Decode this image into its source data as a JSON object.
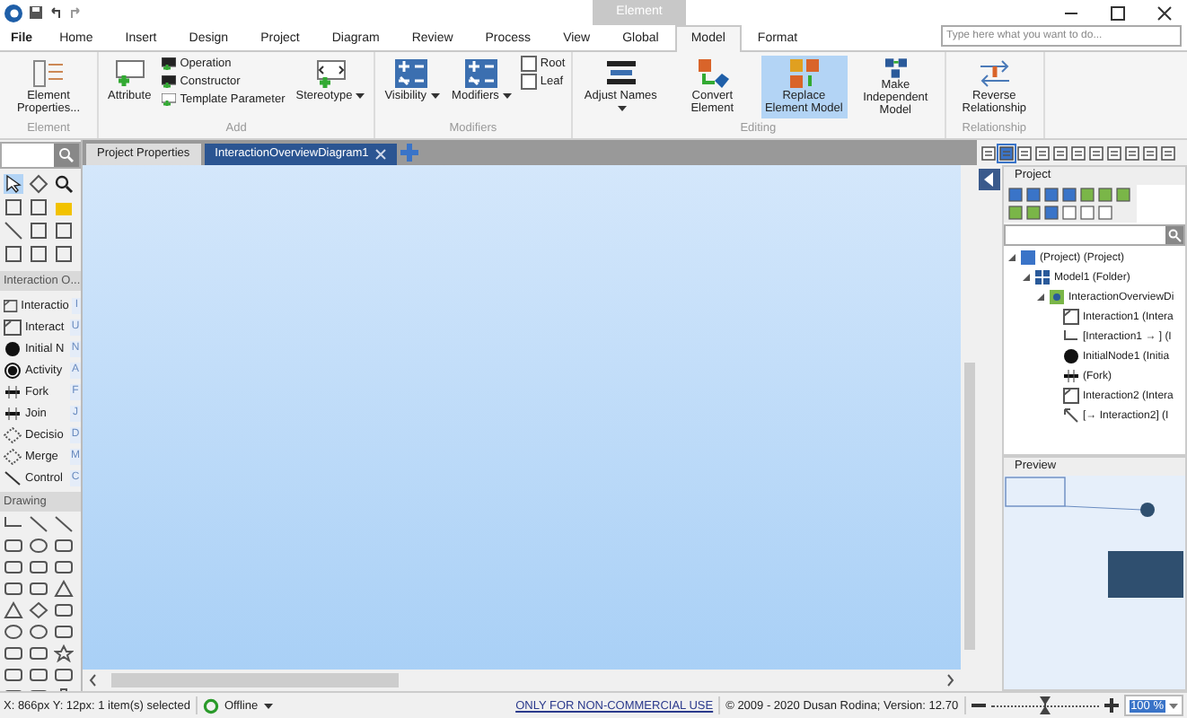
{
  "title_bar": {
    "context_tab": "Element"
  },
  "menu": {
    "tabs": [
      {
        "label": "File",
        "selected": false
      },
      {
        "label": "Home",
        "selected": false
      },
      {
        "label": "Insert",
        "selected": false
      },
      {
        "label": "Design",
        "selected": false
      },
      {
        "label": "Project",
        "selected": false
      },
      {
        "label": "Diagram",
        "selected": false
      },
      {
        "label": "Review",
        "selected": false
      },
      {
        "label": "Process",
        "selected": false
      },
      {
        "label": "View",
        "selected": false
      },
      {
        "label": "Global",
        "selected": false
      },
      {
        "label": "Model",
        "selected": true
      },
      {
        "label": "Format",
        "selected": false
      }
    ],
    "search": {
      "placeholder": "Type here what you want to do..."
    }
  },
  "ribbon": [
    {
      "label": "Element",
      "items": [
        {
          "kind": "large",
          "label": "Element Properties...",
          "active": false,
          "dropdown": false
        }
      ]
    },
    {
      "label": "Add",
      "items": [
        {
          "kind": "large",
          "label": "Attribute",
          "active": false,
          "dropdown": false
        },
        {
          "kind": "stack",
          "entries": [
            "Operation",
            "Constructor",
            "Template Parameter"
          ]
        },
        {
          "kind": "large",
          "label": "Stereotype",
          "active": false,
          "dropdown": true
        }
      ]
    },
    {
      "label": "Modifiers",
      "items": [
        {
          "kind": "large",
          "label": "Visibility",
          "active": false,
          "dropdown": true
        },
        {
          "kind": "large",
          "label": "Modifiers",
          "active": false,
          "dropdown": true
        },
        {
          "kind": "checks",
          "entries": [
            {
              "label": "Root",
              "checked": false
            },
            {
              "label": "Leaf",
              "checked": false
            }
          ]
        }
      ]
    },
    {
      "label": "Editing",
      "items": [
        {
          "kind": "large",
          "label": "Adjust Names",
          "active": false,
          "dropdown": true
        },
        {
          "kind": "large",
          "label": "Convert Element",
          "active": false,
          "dropdown": false
        },
        {
          "kind": "large",
          "label": "Replace Element Model",
          "active": true,
          "dropdown": false
        },
        {
          "kind": "large",
          "label": "Make Independent Model",
          "active": false,
          "dropdown": false
        }
      ]
    },
    {
      "label": "Relationship",
      "items": [
        {
          "kind": "large",
          "label": "Reverse Relationship",
          "active": false,
          "dropdown": false
        }
      ]
    }
  ],
  "document_tabs": [
    {
      "label": "Project Properties",
      "selected": false
    },
    {
      "label": "InteractionOverviewDiagram1",
      "selected": true
    }
  ],
  "toolbox": {
    "section": "Interaction O...",
    "items": [
      {
        "kind": "interaction",
        "label": "Interactio",
        "key": "I"
      },
      {
        "kind": "interaction",
        "label": "Interact",
        "key": "U"
      },
      {
        "kind": "initial",
        "label": "Initial N",
        "key": "N"
      },
      {
        "kind": "activity",
        "label": "Activity",
        "key": "A"
      },
      {
        "kind": "fork",
        "label": "Fork",
        "key": "F"
      },
      {
        "kind": "join",
        "label": "Join",
        "key": "J"
      },
      {
        "kind": "decision",
        "label": "Decisio",
        "key": "D"
      },
      {
        "kind": "merge",
        "label": "Merge",
        "key": "M"
      },
      {
        "kind": "control",
        "label": "Control",
        "key": "C"
      }
    ],
    "drawing_section": "Drawing"
  },
  "project_panel": {
    "title": "Project",
    "tree": [
      {
        "kind": "project",
        "label": "(Project) (Project)",
        "expanded": true,
        "children": [
          {
            "kind": "folder",
            "label": "Model1 (Folder)",
            "expanded": true,
            "children": [
              {
                "kind": "diagram",
                "label": "InteractionOverviewDi",
                "expanded": true,
                "children": [
                  {
                    "kind": "interaction",
                    "label": "Interaction1 (Intera"
                  },
                  {
                    "kind": "flow",
                    "label": "[Interaction1 → ] (I"
                  },
                  {
                    "kind": "initial",
                    "label": "InitialNode1 (Initia"
                  },
                  {
                    "kind": "fork",
                    "label": "(Fork)"
                  },
                  {
                    "kind": "interaction",
                    "label": "Interaction2 (Intera"
                  },
                  {
                    "kind": "arrow",
                    "label": "[→ Interaction2] (I"
                  }
                ]
              }
            ]
          }
        ]
      }
    ]
  },
  "preview_panel": {
    "title": "Preview"
  },
  "status_bar": {
    "position": "X: 866px Y: 12px: 1 item(s) selected",
    "connection": "Offline",
    "license": "ONLY FOR NON-COMMERCIAL USE",
    "copyright": "© 2009 - 2020 Dusan Rodina; Version: 12.70",
    "zoom": {
      "level": 0.5,
      "value": "100 %"
    }
  }
}
